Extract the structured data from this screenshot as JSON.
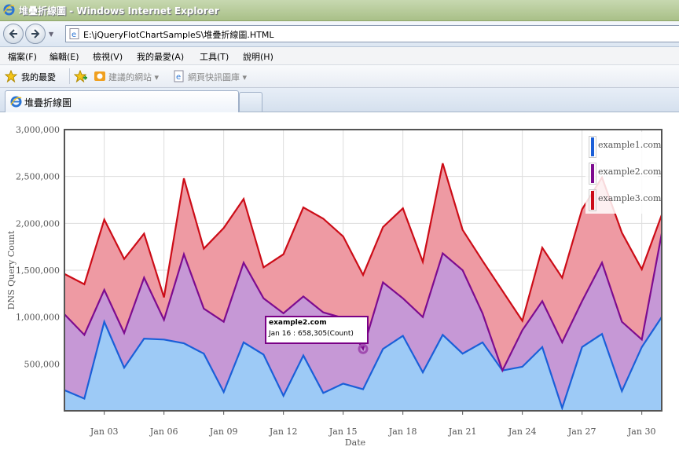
{
  "window": {
    "title": "堆疊折線圖 - Windows Internet Explorer",
    "address": "E:\\jQueryFlotChartSampleS\\堆疊折線圖.HTML",
    "address_icon": "ie-page-icon"
  },
  "menu": [
    "檔案(F)",
    "編輯(E)",
    "檢視(V)",
    "我的最愛(A)",
    "工具(T)",
    "說明(H)"
  ],
  "favorites": {
    "favorites_label": "我的最愛",
    "suggested_label": "建議的網站 ▾",
    "gallery_label": "網頁快訊圖庫 ▾"
  },
  "tab": {
    "label": "堆疊折線圖"
  },
  "chart_data": {
    "type": "area",
    "stacked": true,
    "ylabel": "DNS Query Count",
    "xlabel": "Date",
    "ylim": [
      0,
      3000000
    ],
    "yticks": [
      "500,000",
      "1,000,000",
      "1,500,000",
      "2,000,000",
      "2,500,000",
      "3,000,000"
    ],
    "xticks": [
      "Jan 03",
      "Jan 06",
      "Jan 09",
      "Jan 12",
      "Jan 15",
      "Jan 18",
      "Jan 21",
      "Jan 24",
      "Jan 27",
      "Jan 30"
    ],
    "x_start": "Jan 01",
    "grid": true,
    "legend_position": "top-right",
    "series": [
      {
        "name": "example1.com",
        "color": "#1a5fd8",
        "values": [
          220000,
          130000,
          950000,
          460000,
          770000,
          760000,
          720000,
          610000,
          200000,
          730000,
          600000,
          160000,
          590000,
          190000,
          290000,
          230000,
          660000,
          800000,
          410000,
          810000,
          610000,
          730000,
          430000,
          470000,
          680000,
          30000,
          680000,
          820000,
          210000,
          680000,
          1000000
        ]
      },
      {
        "name": "example2.com",
        "color": "#7d0b8f",
        "values": [
          810000,
          680000,
          340000,
          370000,
          650000,
          210000,
          950000,
          480000,
          750000,
          850000,
          600000,
          880000,
          630000,
          860000,
          700000,
          430000,
          710000,
          400000,
          590000,
          870000,
          890000,
          310000,
          0,
          390000,
          490000,
          700000,
          490000,
          760000,
          740000,
          80000,
          890000
        ]
      },
      {
        "name": "example3.com",
        "color": "#cc0c17",
        "values": [
          430000,
          540000,
          750000,
          790000,
          470000,
          240000,
          810000,
          640000,
          1000000,
          680000,
          330000,
          630000,
          950000,
          1000000,
          870000,
          790000,
          590000,
          960000,
          590000,
          960000,
          430000,
          560000,
          850000,
          100000,
          570000,
          690000,
          980000,
          910000,
          950000,
          750000,
          200000
        ]
      }
    ]
  },
  "tooltip": {
    "title": "example2.com",
    "line": "Jan 16 : 658,305(Count)"
  }
}
